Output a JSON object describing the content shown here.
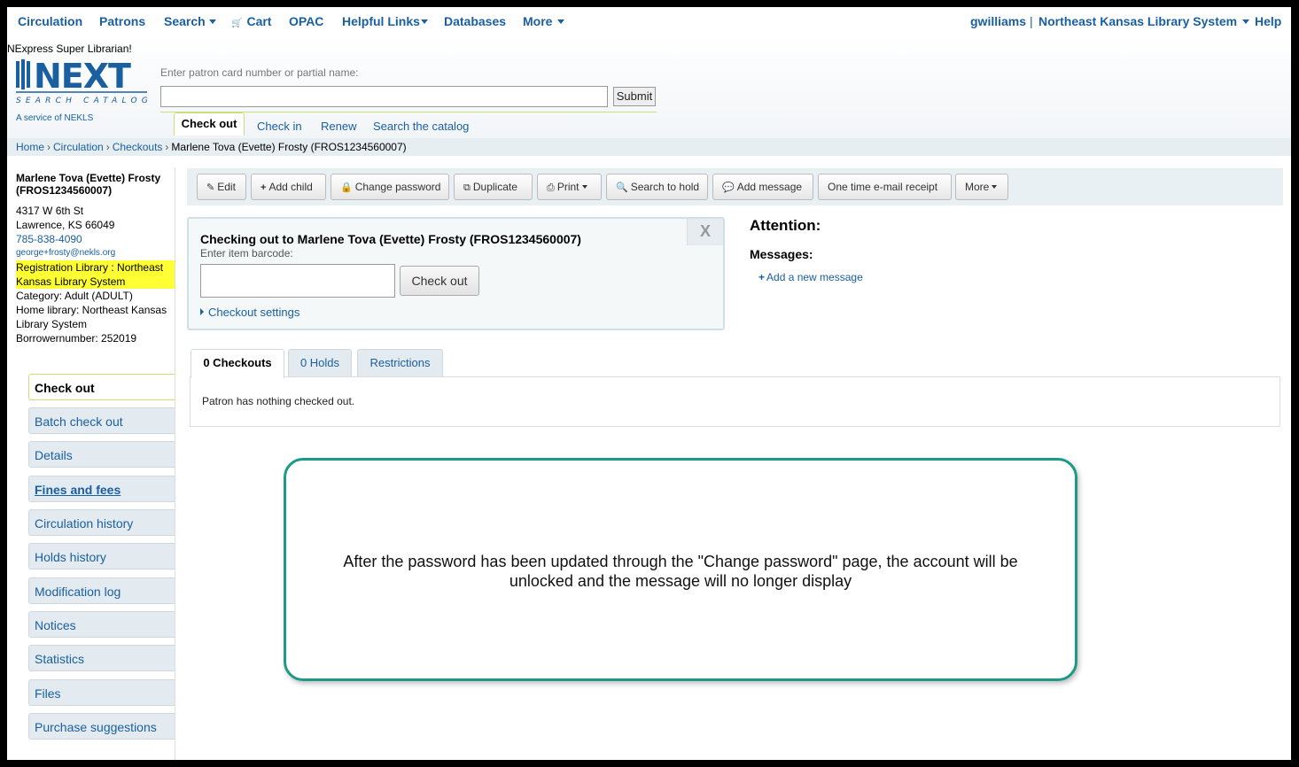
{
  "topnav": {
    "left": [
      {
        "label": "Circulation",
        "caret": false
      },
      {
        "label": "Patrons",
        "caret": false
      },
      {
        "label": "Search",
        "caret": true
      },
      {
        "label": "Cart",
        "caret": false,
        "icon": "cart-icon"
      },
      {
        "label": "OPAC",
        "caret": false
      },
      {
        "label": "Helpful Links",
        "caret": true
      },
      {
        "label": "Databases",
        "caret": false
      },
      {
        "label": "More",
        "caret": true
      }
    ],
    "user": "gwilliams",
    "separator": "|",
    "library": "Northeast Kansas Library System",
    "help": "Help"
  },
  "header": {
    "tagline": "NExpress Super Librarian!",
    "logo_text": "NEXT",
    "logo_subtext": "SEARCH CATALOG",
    "logo_service": "A service of NEKLS",
    "search_label": "Enter patron card number or partial name:",
    "search_value": "",
    "submit_label": "Submit",
    "tabs": [
      "Check out",
      "Check in",
      "Renew",
      "Search the catalog"
    ]
  },
  "breadcrumb": {
    "items": [
      "Home",
      "Circulation",
      "Checkouts"
    ],
    "current": "Marlene Tova (Evette) Frosty (FROS1234560007)",
    "sep": "›"
  },
  "patron": {
    "name": "Marlene Tova (Evette) Frosty (FROS1234560007)",
    "address1": "4317 W 6th St",
    "address2": "Lawrence, KS 66049",
    "phone": "785-838-4090",
    "email": "george+frosty@nekls.org",
    "registration": "Registration Library : Northeast Kansas Library System",
    "category": "Category: Adult (ADULT)",
    "home_library": "Home library: Northeast Kansas Library System",
    "borrowernumber": "Borrowernumber: 252019"
  },
  "sidebar": {
    "items": [
      "Check out",
      "Batch check out",
      "Details",
      "Fines and fees",
      "Circulation history",
      "Holds history",
      "Modification log",
      "Notices",
      "Statistics",
      "Files",
      "Purchase suggestions"
    ]
  },
  "toolbar": {
    "buttons": [
      {
        "label": "Edit",
        "icon": "pencil-icon"
      },
      {
        "label": "Add child",
        "icon": "plus-icon"
      },
      {
        "label": "Change password",
        "icon": "lock-icon"
      },
      {
        "label": "Duplicate",
        "icon": "copy-icon"
      },
      {
        "label": "Print",
        "icon": "printer-icon"
      },
      {
        "label": "Search to hold",
        "icon": "search-icon"
      },
      {
        "label": "Add message",
        "icon": "comment-icon"
      },
      {
        "label": "One time e-mail receipt",
        "icon": ""
      },
      {
        "label": "More",
        "icon": ""
      }
    ]
  },
  "checkout": {
    "title": "Checking out to Marlene Tova (Evette) Frosty (FROS1234560007)",
    "hint": "Enter item barcode:",
    "barcode_value": "",
    "button": "Check out",
    "settings": "Checkout settings",
    "close": "X"
  },
  "attention": {
    "title": "Attention:",
    "messages_title": "Messages:",
    "add_message": "Add a new message"
  },
  "tabs": {
    "items": [
      "0 Checkouts",
      "0 Holds",
      "Restrictions"
    ],
    "panel_text": "Patron has nothing checked out."
  },
  "callout": {
    "text": "After the password has been updated through the \"Change password\" page, the account will be unlocked and the message will no longer display"
  },
  "colors": {
    "link": "#1a5fa0",
    "highlight": "#ffff33",
    "callout_border": "#1c9a86",
    "active_accent": "#c8e07a"
  }
}
